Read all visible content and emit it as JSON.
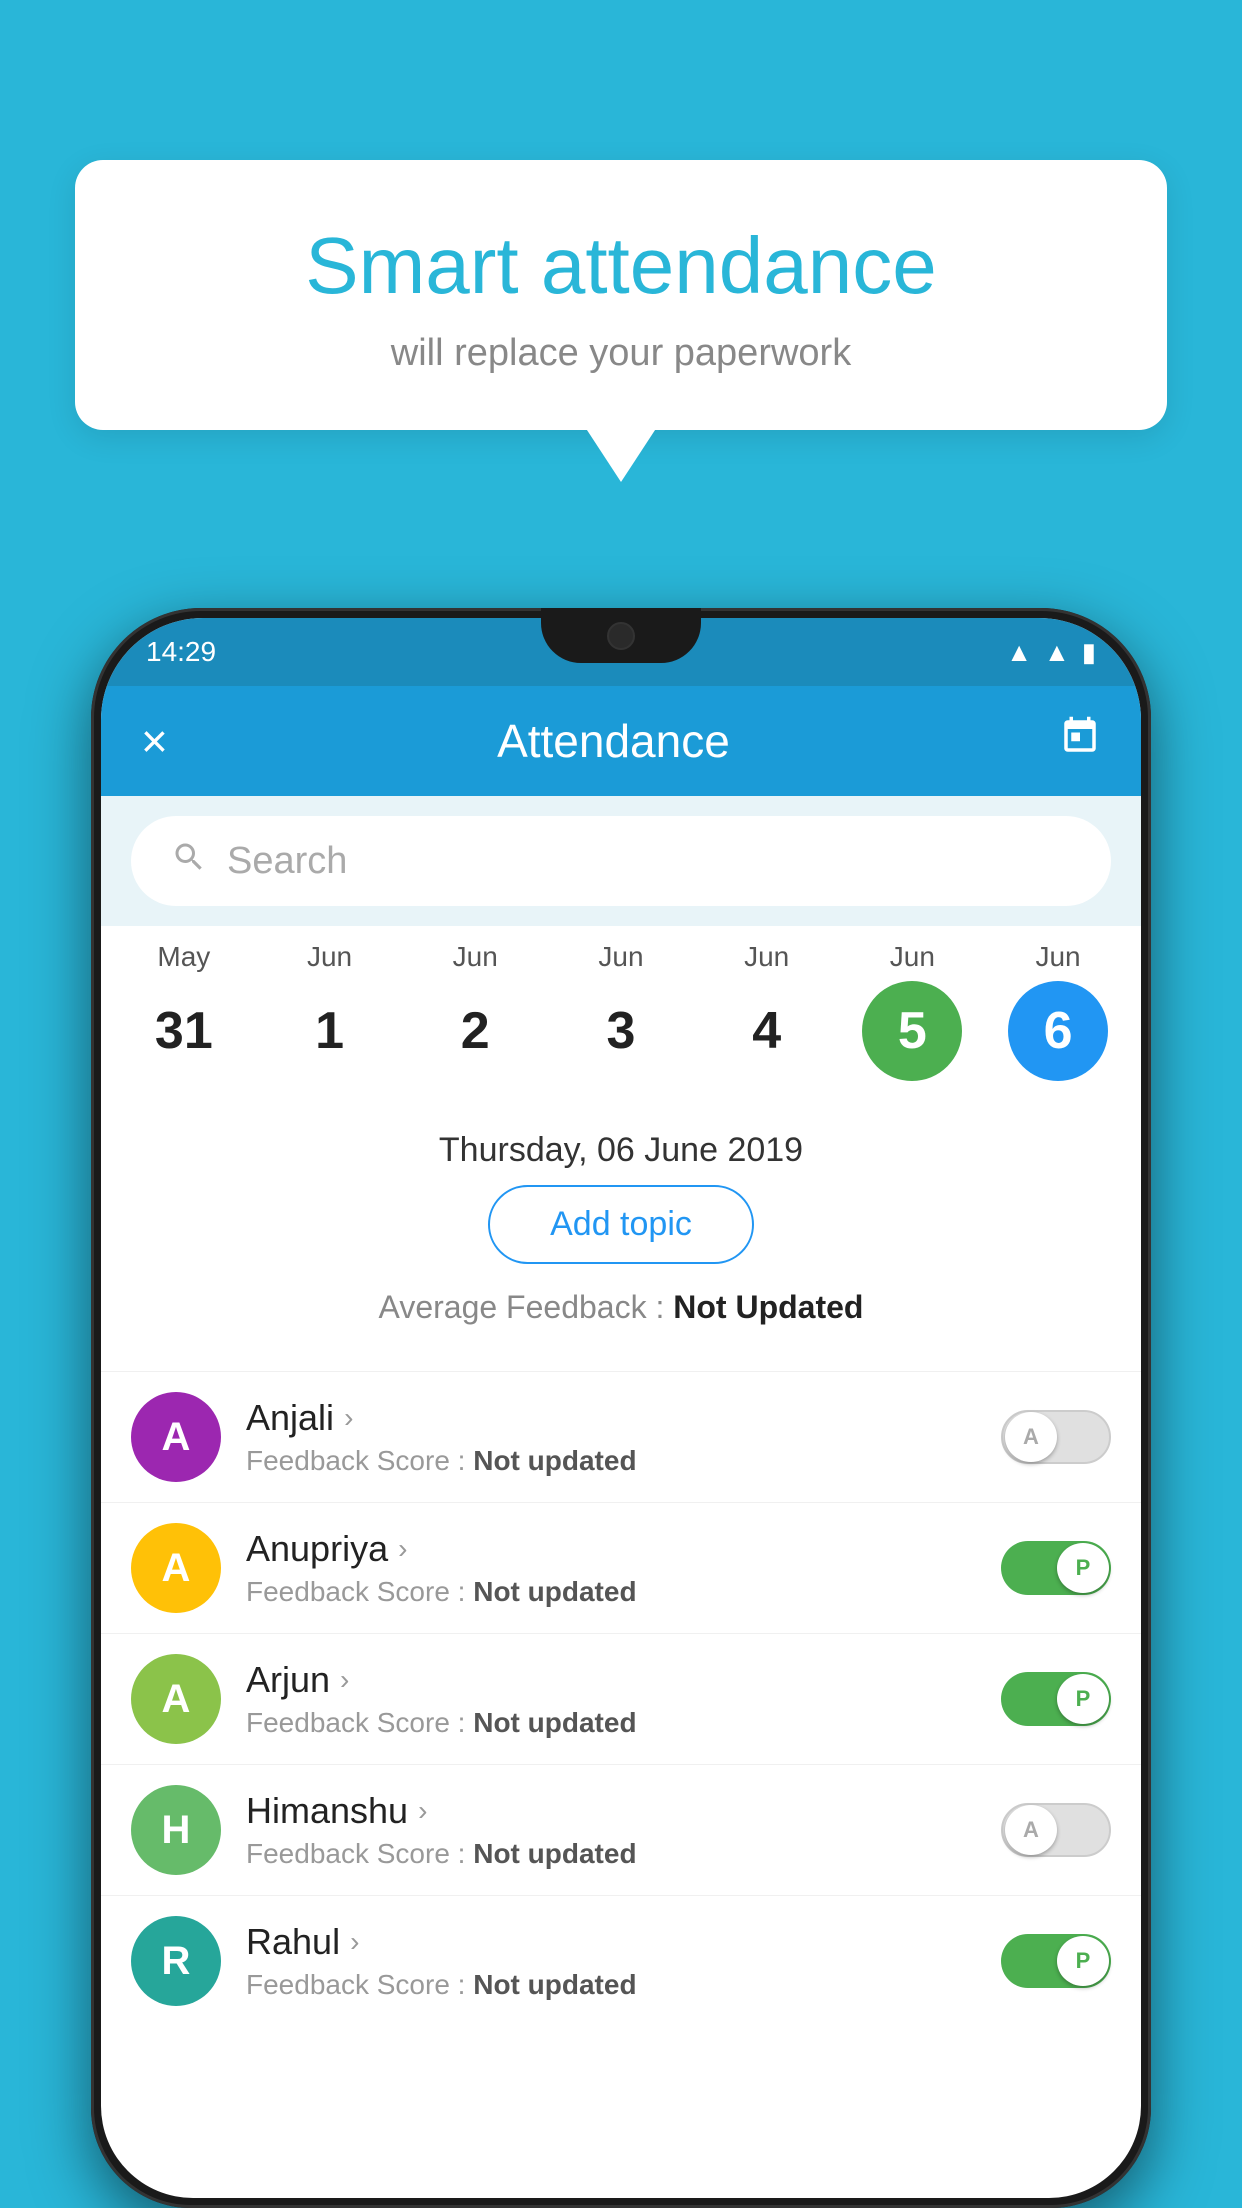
{
  "background_color": "#29B6D8",
  "speech_bubble": {
    "title": "Smart attendance",
    "subtitle": "will replace your paperwork"
  },
  "status_bar": {
    "time": "14:29",
    "wifi": "▲",
    "signal": "◀",
    "battery": "▮"
  },
  "app_header": {
    "title": "Attendance",
    "close_label": "×",
    "calendar_icon": "📅"
  },
  "search": {
    "placeholder": "Search"
  },
  "calendar": {
    "days": [
      {
        "month": "May",
        "date": "31",
        "state": "normal"
      },
      {
        "month": "Jun",
        "date": "1",
        "state": "normal"
      },
      {
        "month": "Jun",
        "date": "2",
        "state": "normal"
      },
      {
        "month": "Jun",
        "date": "3",
        "state": "normal"
      },
      {
        "month": "Jun",
        "date": "4",
        "state": "normal"
      },
      {
        "month": "Jun",
        "date": "5",
        "state": "today"
      },
      {
        "month": "Jun",
        "date": "6",
        "state": "selected"
      }
    ]
  },
  "selected_date": "Thursday, 06 June 2019",
  "add_topic_label": "Add topic",
  "feedback_avg_label": "Average Feedback : ",
  "feedback_avg_value": "Not Updated",
  "students": [
    {
      "name": "Anjali",
      "avatar_letter": "A",
      "avatar_color": "purple",
      "feedback_label": "Feedback Score : ",
      "feedback_value": "Not updated",
      "toggle_state": "off",
      "toggle_letter": "A"
    },
    {
      "name": "Anupriya",
      "avatar_letter": "A",
      "avatar_color": "yellow",
      "feedback_label": "Feedback Score : ",
      "feedback_value": "Not updated",
      "toggle_state": "on",
      "toggle_letter": "P"
    },
    {
      "name": "Arjun",
      "avatar_letter": "A",
      "avatar_color": "light-green",
      "feedback_label": "Feedback Score : ",
      "feedback_value": "Not updated",
      "toggle_state": "on",
      "toggle_letter": "P"
    },
    {
      "name": "Himanshu",
      "avatar_letter": "H",
      "avatar_color": "green",
      "feedback_label": "Feedback Score : ",
      "feedback_value": "Not updated",
      "toggle_state": "off",
      "toggle_letter": "A"
    },
    {
      "name": "Rahul",
      "avatar_letter": "R",
      "avatar_color": "teal",
      "feedback_label": "Feedback Score : ",
      "feedback_value": "Not updated",
      "toggle_state": "on",
      "toggle_letter": "P"
    }
  ]
}
